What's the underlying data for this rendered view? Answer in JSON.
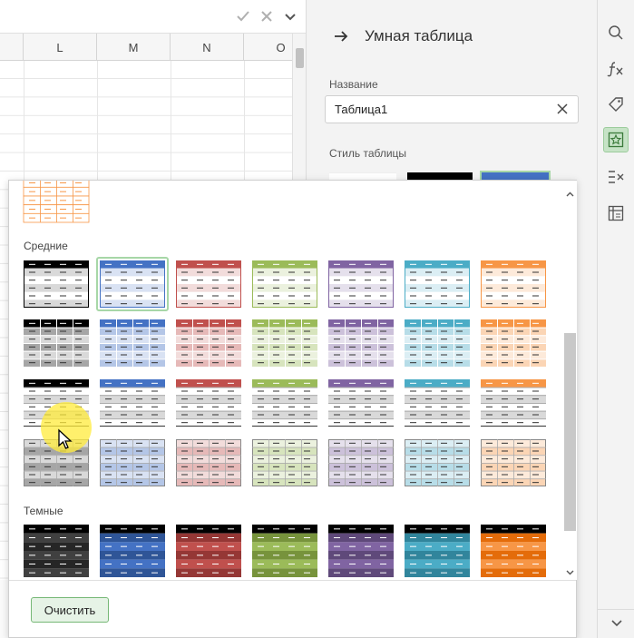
{
  "formula_bar": {
    "accept_icon": "check-icon",
    "cancel_icon": "close-icon",
    "expand_icon": "chevron-down-icon"
  },
  "columns": [
    "L",
    "M",
    "N",
    "O"
  ],
  "panel": {
    "title": "Умная таблица",
    "name_label": "Название",
    "name_value": "Таблица1",
    "style_label": "Стиль таблицы"
  },
  "sidebar": {
    "items": [
      {
        "icon": "search-icon"
      },
      {
        "icon": "function-icon"
      },
      {
        "icon": "tag-icon"
      },
      {
        "icon": "table-style-icon",
        "active": true
      },
      {
        "icon": "remove-duplicates-icon"
      },
      {
        "icon": "pivot-table-icon"
      }
    ]
  },
  "popup": {
    "sections": [
      {
        "title": "Средние"
      },
      {
        "title": "Темные"
      }
    ],
    "clear_label": "Очистить"
  },
  "colors": {
    "accent": "#76b876",
    "palette": [
      "#000000",
      "#4472c4",
      "#c0504d",
      "#9bbb59",
      "#8064a2",
      "#4bacc6",
      "#f79646"
    ]
  }
}
